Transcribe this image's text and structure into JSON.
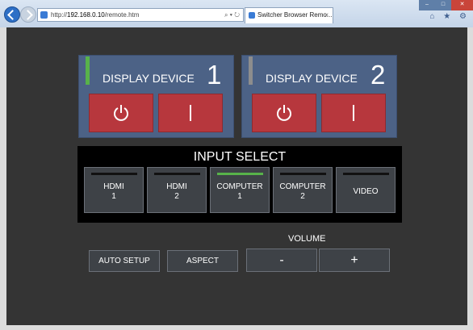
{
  "browser": {
    "address_prefix": "http://",
    "address_host": "192.168.0.10",
    "address_path": "/remote.htm",
    "address_controls": "⌕ ▾ ↻",
    "tab_title": "Switcher Browser Remo...",
    "tab_close": "×",
    "window_min": "–",
    "window_max": "□",
    "window_close": "✕",
    "toolbar_icons": "⌂ ★ ⚙"
  },
  "devices": [
    {
      "label": "DISPLAY DEVICE",
      "number": "1",
      "indicator": "#58b24a"
    },
    {
      "label": "DISPLAY DEVICE",
      "number": "2",
      "indicator": "#8d8d8d"
    }
  ],
  "input_select": {
    "title": "INPUT SELECT",
    "options": [
      {
        "line1": "HDMI",
        "line2": "1",
        "selected": false
      },
      {
        "line1": "HDMI",
        "line2": "2",
        "selected": false
      },
      {
        "line1": "COMPUTER",
        "line2": "1",
        "selected": true
      },
      {
        "line1": "COMPUTER",
        "line2": "2",
        "selected": false
      },
      {
        "line1": "VIDEO",
        "line2": "",
        "selected": false
      }
    ]
  },
  "controls": {
    "auto_setup": "AUTO SETUP",
    "aspect": "ASPECT",
    "volume_label": "VOLUME",
    "volume_down": "-",
    "volume_up": "+"
  },
  "colors": {
    "panel_blue": "#4c6286",
    "power_red": "#b7373d",
    "selected_green": "#58b24a",
    "background": "#343434"
  }
}
